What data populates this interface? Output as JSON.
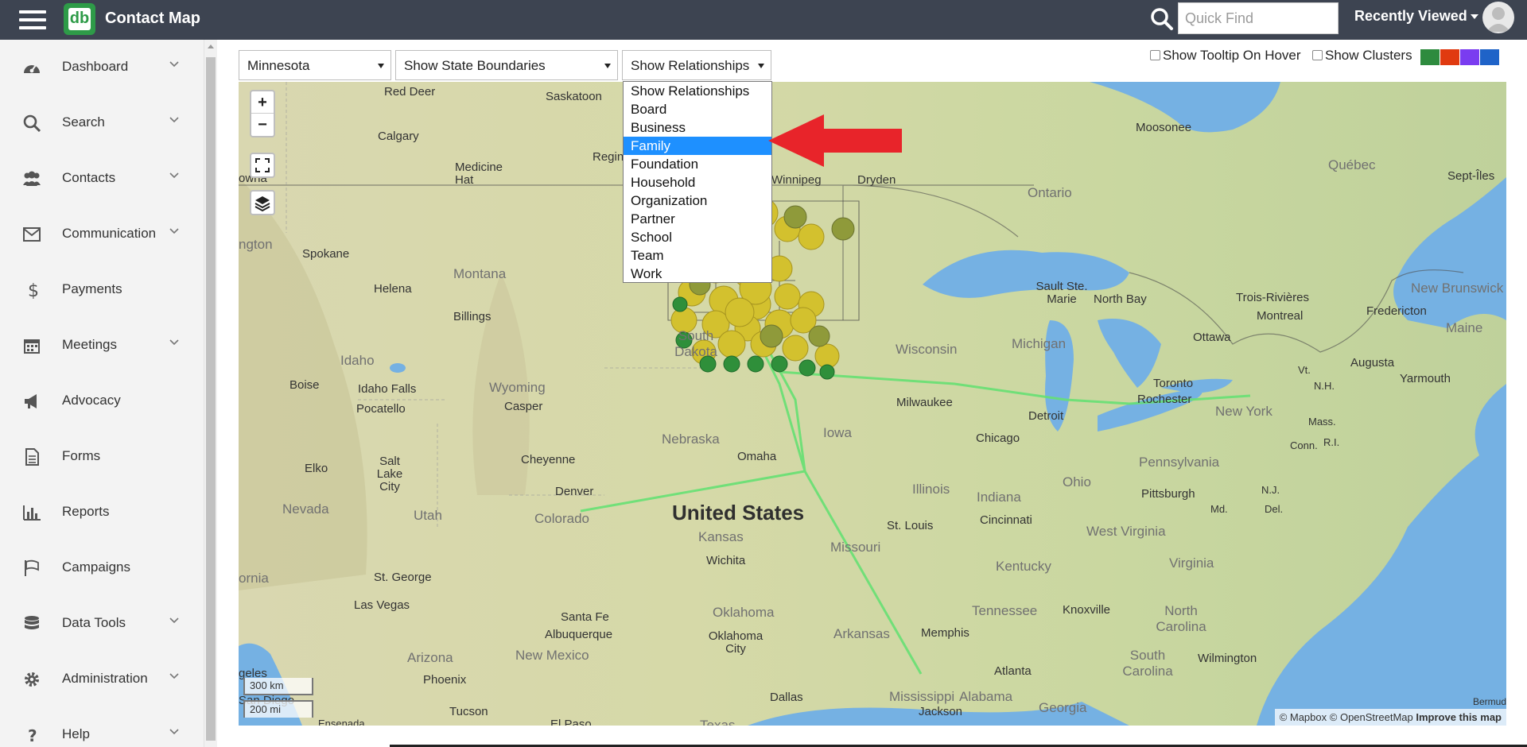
{
  "header": {
    "app_title": "Contact Map",
    "logo_text": "db",
    "quick_find_placeholder": "Quick Find",
    "recently_viewed": "Recently Viewed"
  },
  "sidebar": {
    "items": [
      {
        "label": "Dashboard",
        "icon": "dashboard-gauge-icon",
        "has_submenu": true
      },
      {
        "label": "Search",
        "icon": "search-icon",
        "has_submenu": true
      },
      {
        "label": "Contacts",
        "icon": "users-icon",
        "has_submenu": true
      },
      {
        "label": "Communication",
        "icon": "envelope-icon",
        "has_submenu": true
      },
      {
        "label": "Payments",
        "icon": "dollar-icon",
        "has_submenu": false
      },
      {
        "label": "Meetings",
        "icon": "calendar-icon",
        "has_submenu": true
      },
      {
        "label": "Advocacy",
        "icon": "megaphone-icon",
        "has_submenu": false
      },
      {
        "label": "Forms",
        "icon": "document-icon",
        "has_submenu": false
      },
      {
        "label": "Reports",
        "icon": "bar-chart-icon",
        "has_submenu": false
      },
      {
        "label": "Campaigns",
        "icon": "flag-icon",
        "has_submenu": false
      },
      {
        "label": "Data Tools",
        "icon": "database-icon",
        "has_submenu": true
      },
      {
        "label": "Administration",
        "icon": "gear-icon",
        "has_submenu": true
      },
      {
        "label": "Help",
        "icon": "question-icon",
        "has_submenu": true
      }
    ]
  },
  "toolbar": {
    "state_select": "Minnesota",
    "boundaries_select": "Show State Boundaries",
    "relationships_select": "Show Relationships",
    "tooltip_checkbox": "Show Tooltip On Hover",
    "clusters_checkbox": "Show Clusters",
    "cluster_colors": [
      "#2e8b3e",
      "#e03a10",
      "#7a3cf0",
      "#1f63c8"
    ]
  },
  "relationship_dropdown": {
    "options": [
      "Show Relationships",
      "Board",
      "Business",
      "Family",
      "Foundation",
      "Household",
      "Organization",
      "Partner",
      "School",
      "Team",
      "Work"
    ],
    "highlighted": "Family"
  },
  "map": {
    "zoom_in": "+",
    "zoom_out": "−",
    "scale_km": "300 km",
    "scale_mi": "200 mi",
    "attribution_mapbox": "© Mapbox",
    "attribution_osm": "© OpenStreetMap",
    "attribution_improve": "Improve this map",
    "country_label": "United States",
    "region_labels": [
      "Ontario",
      "Québec",
      "Montana",
      "South Dakota",
      "Wyoming",
      "Idaho",
      "Nebraska",
      "Iowa",
      "Nevada",
      "Utah",
      "Colorado",
      "Kansas",
      "Missouri",
      "Illinois",
      "Indiana",
      "Ohio",
      "Michigan",
      "Wisconsin",
      "Pennsylvania",
      "West Virginia",
      "Kentucky",
      "Virginia",
      "Tennessee",
      "North Carolina",
      "South Carolina",
      "Georgia",
      "Alabama",
      "Mississippi",
      "Arkansas",
      "Oklahoma",
      "New Mexico",
      "Arizona",
      "New York",
      "Maine",
      "New Brunswick",
      "Vt.",
      "N.H.",
      "Mass.",
      "Conn.",
      "R.I.",
      "N.J.",
      "Md.",
      "Del.",
      "ornia",
      "ngton",
      "Bermud"
    ],
    "city_labels": [
      "Red Deer",
      "Saskatoon",
      "Calgary",
      "Medicine Hat",
      "Regin",
      "owna",
      "Spokane",
      "Helena",
      "Billings",
      "Boise",
      "Idaho Falls",
      "Pocatello",
      "Casper",
      "Cheyenne",
      "Elko",
      "Salt Lake City",
      "Denver",
      "Omaha",
      "Wichita",
      "St. George",
      "Las Vegas",
      "Santa Fe",
      "Albuquerque",
      "Oklahoma City",
      "Phoenix",
      "Tucson",
      "El Paso",
      "Dallas",
      "Texas",
      "Jackson",
      "Memphis",
      "Atlanta",
      "St. Louis",
      "Chicago",
      "Milwaukee",
      "Detroit",
      "Cincinnati",
      "Pittsburgh",
      "Knoxville",
      "Toronto",
      "Rochester",
      "Ottawa",
      "Montreal",
      "Trois-Rivières",
      "Fredericton",
      "Augusta",
      "Yarmouth",
      "Moosonee",
      "Sept-Îles",
      "Dryden",
      "Winnipeg",
      "Sault Ste. Marie",
      "North Bay",
      "Wilmington",
      "geles",
      "San Diego",
      "Ensenada"
    ]
  }
}
